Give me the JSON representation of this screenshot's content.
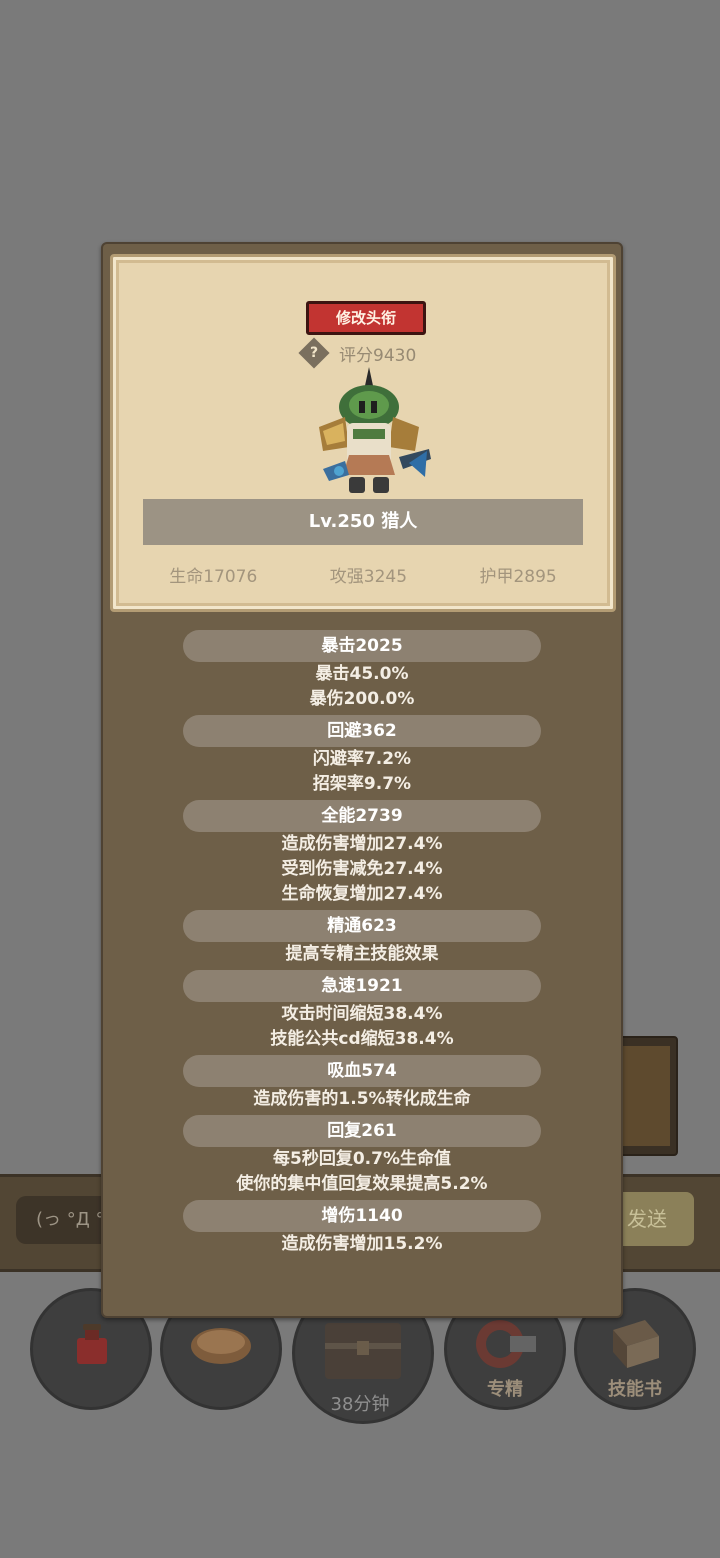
{
  "background": {
    "chat_input_text": "(っ °Д °",
    "send_button": "发送",
    "bottom_buttons": [
      {
        "name": "potion",
        "label": ""
      },
      {
        "name": "bread",
        "label": ""
      },
      {
        "name": "chest",
        "label": ""
      },
      {
        "name": "specialization",
        "label": "专精"
      },
      {
        "name": "skill-book",
        "label": "技能书"
      }
    ],
    "chest_timer": "38分钟"
  },
  "profile": {
    "title_button": "修改头衔",
    "score": "评分9430",
    "name": "Lv.250 猎人",
    "base_stats": [
      "生命17076",
      "攻强3245",
      "护甲2895"
    ]
  },
  "stats": [
    {
      "header": "暴击2025",
      "lines": [
        "暴击45.0%",
        "暴伤200.0%"
      ]
    },
    {
      "header": "回避362",
      "lines": [
        "闪避率7.2%",
        "招架率9.7%"
      ]
    },
    {
      "header": "全能2739",
      "lines": [
        "造成伤害增加27.4%",
        "受到伤害减免27.4%",
        "生命恢复增加27.4%"
      ]
    },
    {
      "header": "精通623",
      "lines": [
        "提高专精主技能效果"
      ]
    },
    {
      "header": "急速1921",
      "lines": [
        "攻击时间缩短38.4%",
        "技能公共cd缩短38.4%"
      ]
    },
    {
      "header": "吸血574",
      "lines": [
        "造成伤害的1.5%转化成生命"
      ]
    },
    {
      "header": "回复261",
      "lines": [
        "每5秒回复0.7%生命值",
        "使你的集中值回复效果提高5.2%"
      ]
    },
    {
      "header": "增伤1140",
      "lines": [
        "造成伤害增加15.2%"
      ]
    }
  ],
  "colors": {
    "overlay": "#7a7a7a",
    "panel": "#6e5f48",
    "parchment": "#e7d5b0",
    "title_button": "#c23431"
  }
}
